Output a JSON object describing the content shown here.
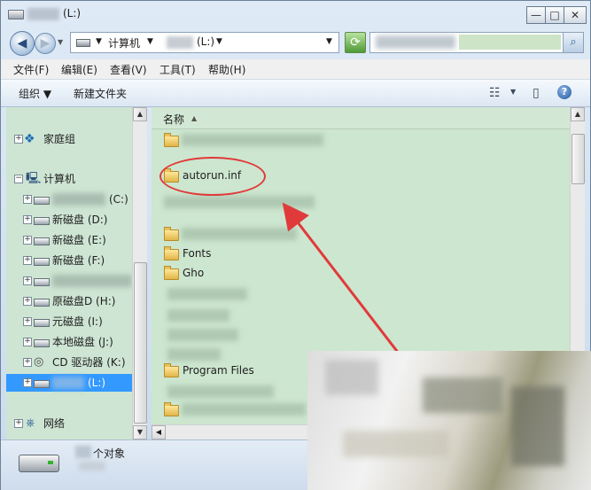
{
  "window": {
    "title": "(L:)",
    "minimize": "—",
    "maximize": "□",
    "close": "✕"
  },
  "address": {
    "back": "◀",
    "forward": "▶",
    "seg_computer": "计算机",
    "seg_drive": "(L:)",
    "sep": "▼",
    "search_icon": "magnifier-icon"
  },
  "menu": [
    "文件(F)",
    "编辑(E)",
    "查看(V)",
    "工具(T)",
    "帮助(H)"
  ],
  "toolbar": {
    "organize": "组织 ▼",
    "new_folder": "新建文件夹",
    "help": "?"
  },
  "nav": {
    "homegroup": "家庭组",
    "computer": "计算机",
    "drives": [
      {
        "label": "(C:)"
      },
      {
        "label": "新磁盘 (D:)"
      },
      {
        "label": "新磁盘 (E:)"
      },
      {
        "label": "新磁盘 (F:)"
      },
      {
        "label": ""
      },
      {
        "label": "原磁盘D (H:)"
      },
      {
        "label": "元磁盘 (I:)"
      },
      {
        "label": "本地磁盘 (J:)"
      },
      {
        "label": "CD 驱动器 (K:)"
      },
      {
        "label": "(L:)"
      }
    ],
    "network": "网络"
  },
  "content": {
    "column_name": "名称",
    "rows": [
      "autorun.inf",
      "Fonts",
      "Gho",
      "Program Files"
    ]
  },
  "status": {
    "text": "个对象"
  },
  "colors": {
    "selection": "#3399ff",
    "annotation": "#e03a3a",
    "pane_bg": "#cde6cf"
  }
}
